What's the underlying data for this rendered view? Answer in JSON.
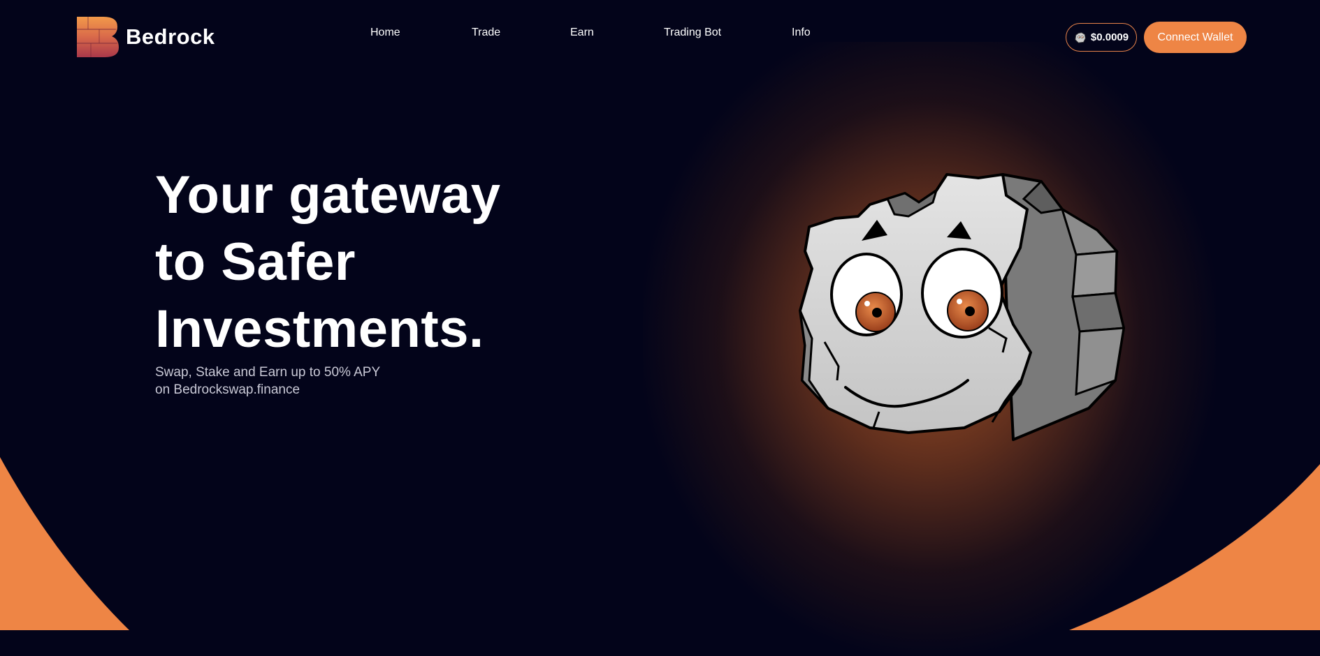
{
  "brand": {
    "name": "Bedrock"
  },
  "nav": {
    "items": [
      {
        "label": "Home"
      },
      {
        "label": "Trade"
      },
      {
        "label": "Earn"
      },
      {
        "label": "Trading Bot"
      },
      {
        "label": "Info"
      }
    ]
  },
  "token_price": {
    "icon": "rock-token-icon",
    "value": "$0.0009"
  },
  "connect_wallet": {
    "label": "Connect Wallet"
  },
  "hero": {
    "title_lines": [
      "Your gateway",
      "to Safer",
      "Investments."
    ],
    "subtitle_lines": [
      "Swap, Stake and Earn up to 50% APY",
      "on Bedrockswap.finance"
    ]
  },
  "colors": {
    "background": "#03041a",
    "accent": "#ee8545",
    "text": "#ffffff",
    "muted_text": "#c9c9d6"
  }
}
